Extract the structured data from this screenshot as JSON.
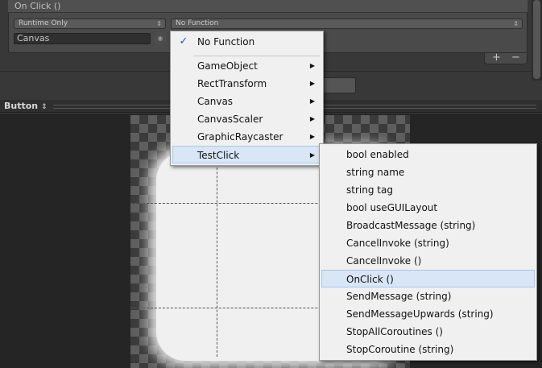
{
  "event": {
    "title": "On Click ()",
    "call_state": "Runtime Only",
    "function": "No Function",
    "object": "Canvas",
    "add_symbol": "+",
    "remove_symbol": "−"
  },
  "preview": {
    "label": "Button",
    "label_arrow": "⇕"
  },
  "dropdown_menu": {
    "selected_check": "✓",
    "items": [
      {
        "label": "No Function"
      },
      {
        "label": "GameObject"
      },
      {
        "label": "RectTransform"
      },
      {
        "label": "Canvas"
      },
      {
        "label": "CanvasScaler"
      },
      {
        "label": "GraphicRaycaster"
      },
      {
        "label": "TestClick"
      }
    ],
    "submenu_arrow": "▶"
  },
  "submenu": {
    "items": [
      {
        "label": "bool enabled"
      },
      {
        "label": "string name"
      },
      {
        "label": "string tag"
      },
      {
        "label": "bool useGUILayout"
      },
      {
        "label": "BroadcastMessage (string)"
      },
      {
        "label": "CancelInvoke (string)"
      },
      {
        "label": "CancelInvoke ()"
      },
      {
        "label": "OnClick ()"
      },
      {
        "label": "SendMessage (string)"
      },
      {
        "label": "SendMessageUpwards (string)"
      },
      {
        "label": "StopAllCoroutines ()"
      },
      {
        "label": "StopCoroutine (string)"
      }
    ]
  },
  "colors": {
    "menu_bg": "#f0f0f0",
    "highlight": "#d8e6f6",
    "panel_bg": "#383838"
  }
}
